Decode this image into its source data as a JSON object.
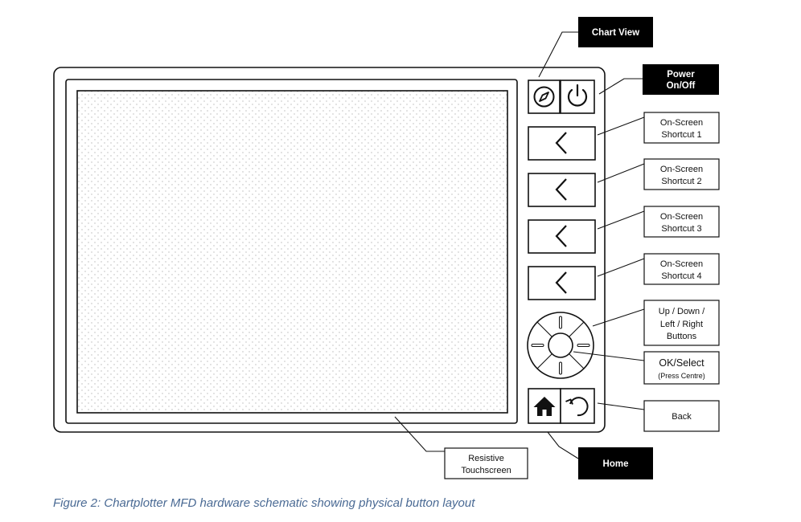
{
  "caption": "Figure 2: Chartplotter MFD hardware schematic showing physical button layout",
  "labels": {
    "chart_view": "Chart View",
    "power": [
      "Power",
      "On/Off"
    ],
    "shortcut1": [
      "On-Screen",
      "Shortcut 1"
    ],
    "shortcut2": [
      "On-Screen",
      "Shortcut 2"
    ],
    "shortcut3": [
      "On-Screen",
      "Shortcut 3"
    ],
    "shortcut4": [
      "On-Screen",
      "Shortcut 4"
    ],
    "dpad": [
      "Up / Down /",
      "Left / Right",
      "Buttons"
    ],
    "ok_select": [
      "OK/Select",
      "(Press Centre)"
    ],
    "back": "Back",
    "home": "Home",
    "touchscreen": [
      "Resistive",
      "Touchscreen"
    ]
  },
  "icons": {
    "chart_view": "compass-icon",
    "power": "power-icon",
    "shortcuts": "chevron-left-icon",
    "home": "home-icon",
    "back": "back-arrow-icon"
  },
  "colors": {
    "stroke": "#111111",
    "callout_dark_bg": "#000000",
    "caption": "#4a6a94",
    "screen_dots": "#b8b8b8"
  }
}
